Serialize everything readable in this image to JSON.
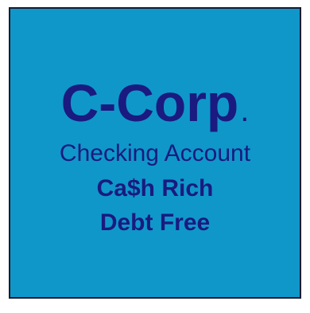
{
  "panel": {
    "background_color": "#0f97c9",
    "text_color": "#1a1a80",
    "title": "C-Corp",
    "title_suffix": ".",
    "subtitle": "Checking Account",
    "line_1": "Ca$h Rich",
    "line_2": "Debt Free"
  }
}
